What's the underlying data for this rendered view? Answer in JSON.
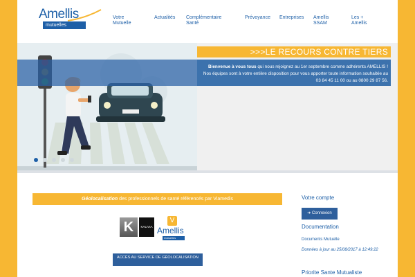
{
  "header": {
    "logo_word": "Amellis",
    "logo_sub": "mutuelles",
    "nav": [
      {
        "label": "Votre\nMutuelle"
      },
      {
        "label": "Actualités"
      },
      {
        "label": "Complémentaire\nSanté"
      },
      {
        "label": "Prévoyance"
      },
      {
        "label": "Entreprises"
      },
      {
        "label": "Amellis\nSSAM"
      },
      {
        "label": "Les +\nAmellis"
      }
    ]
  },
  "banner": {
    "title": ">>>LE RECOURS CONTRE TIERS",
    "message_lead": "Bienvenue à vous tous",
    "message_rest": " qui nous rejoignez au 1er septembre comme adhérents AMELLIS ! Nos équipes sont à votre entière disposition pour vous apporter toute information souhaitée au 03 84 45 11 00 ou au 0800 29 87 56.",
    "slide_count": 5,
    "active_slide": 0
  },
  "geoloc": {
    "lead": "Géolocalisation",
    "rest": " des professionnels de santé référencés par Viamedis",
    "kalivia_letter": "K",
    "kalivia_label": "KALIVIA",
    "v_badge": "V",
    "small_logo": "Amellis",
    "small_logo_sub": "mutuelles",
    "button_label": "ACCÈS AU SERVICE DE GÉOLOCALISATION"
  },
  "sidebar": {
    "account_title": "Votre compte",
    "login_label": "➔ Connexion",
    "docs_title": "Documentation",
    "docs_link": "Documents Mutuelle",
    "docs_note": "Données à jour au 25/08/2017 à 12:49:22",
    "priority_title": "Priorite Sante Mutualiste"
  },
  "colors": {
    "brand_blue": "#1d5fa7",
    "accent_yellow": "#f7b733",
    "button_blue": "#2e5f9c"
  }
}
